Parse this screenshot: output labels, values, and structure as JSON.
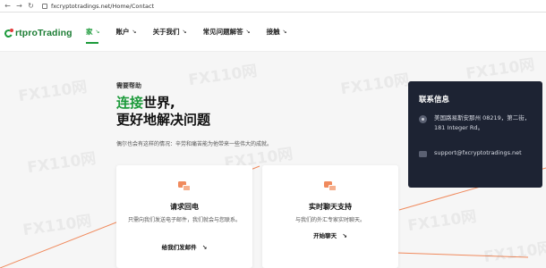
{
  "browser": {
    "url": "fxcryptotradings.net/Home/Contact"
  },
  "header": {
    "logo_text": "rtproTrading",
    "nav": [
      {
        "label": "家",
        "active": true
      },
      {
        "label": "账户",
        "active": false
      },
      {
        "label": "关于我们",
        "active": false
      },
      {
        "label": "常见问题解答",
        "active": false
      },
      {
        "label": "接触",
        "active": false
      }
    ]
  },
  "hero": {
    "eyebrow": "需要帮助",
    "title_highlight": "连接",
    "title_rest_line1": "世界,",
    "title_line2": "更好地解决问题",
    "subtitle": "偶尔也会有这样的情况：辛劳和痛苦能为他带来一些伟大的成就。"
  },
  "cards": [
    {
      "title": "请求回电",
      "description": "只需向我们发送电子邮件，我们就会与您联系。",
      "link": "给我们发邮件"
    },
    {
      "title": "实时聊天支持",
      "description": "与我们的外汇专家实时聊天。",
      "link": "开始聊天"
    }
  ],
  "contact_info": {
    "title": "联系信息",
    "address": "美国路易斯安那州 08219，第二街，181 Integer Rd。",
    "email": "support@fxcryptotradings.net"
  },
  "watermark": "FX110网",
  "colors": {
    "brand_green": "#1c9a3a",
    "accent_orange": "#f08a5d",
    "info_bg": "#1d2333"
  }
}
